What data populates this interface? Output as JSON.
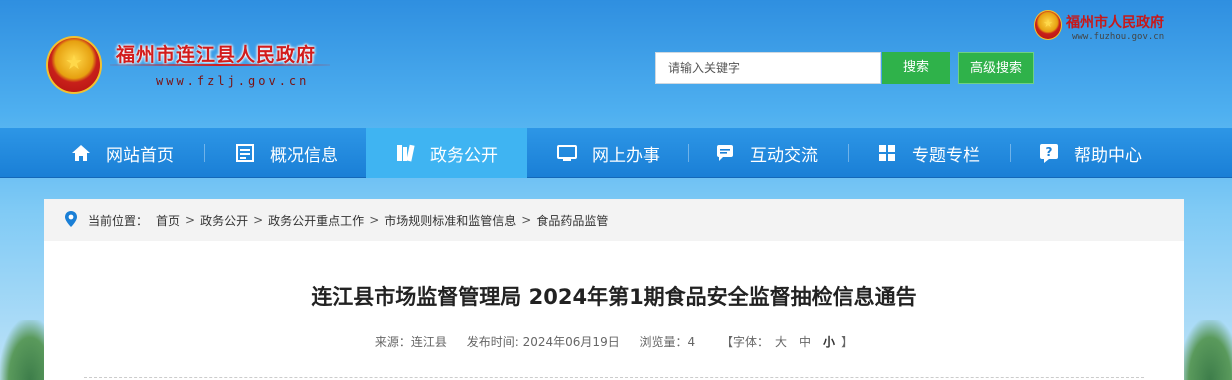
{
  "header": {
    "site_title": "福州市连江县人民政府",
    "site_url": "www.fzlj.gov.cn",
    "fuzhou_title": "福州市人民政府",
    "fuzhou_url": "www.fuzhou.gov.cn",
    "search_placeholder": "请输入关键字",
    "search_button": "搜索",
    "advanced_search_button": "高级搜索"
  },
  "nav": {
    "items": [
      {
        "label": "网站首页",
        "icon": "home-icon"
      },
      {
        "label": "概况信息",
        "icon": "document-icon"
      },
      {
        "label": "政务公开",
        "icon": "book-icon",
        "active": true
      },
      {
        "label": "网上办事",
        "icon": "monitor-icon"
      },
      {
        "label": "互动交流",
        "icon": "chat-icon"
      },
      {
        "label": "专题专栏",
        "icon": "grid-icon"
      },
      {
        "label": "帮助中心",
        "icon": "help-icon"
      }
    ]
  },
  "breadcrumb": {
    "prefix": "当前位置：",
    "items": [
      "首页",
      "政务公开",
      "政务公开重点工作",
      "市场规则标准和监管信息",
      "食品药品监管"
    ]
  },
  "article": {
    "title": "连江县市场监督管理局 2024年第1期食品安全监督抽检信息通告",
    "source": "来源：连江县",
    "publish_time": "发布时间: 2024年06月19日",
    "views": "浏览量：4",
    "font_size_label": "【字体：",
    "font_large": "大",
    "font_medium": "中",
    "font_small": "小",
    "font_size_close": "】"
  },
  "colors": {
    "nav_bg": "#1a7fd6",
    "nav_active": "#3fb4f2",
    "button_green": "#2fb24a",
    "title_red": "#d21c1c"
  }
}
